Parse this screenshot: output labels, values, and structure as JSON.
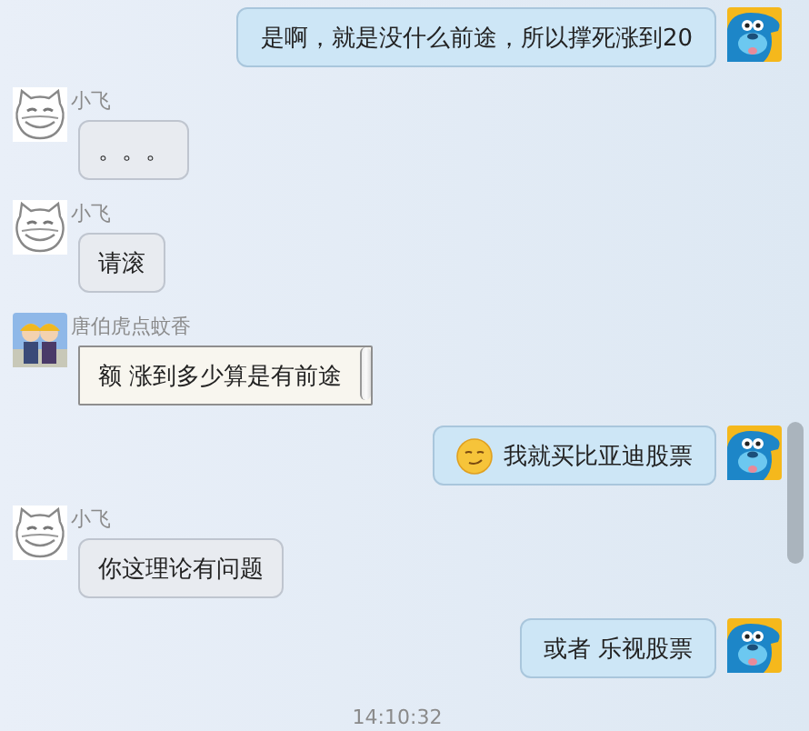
{
  "messages": [
    {
      "outgoing": true,
      "avatar": {
        "kind": "dog"
      },
      "bubble": {
        "kind": "plain"
      },
      "text": "是啊，就是没什么前途，所以撑死涨到20"
    },
    {
      "outgoing": false,
      "avatar": {
        "kind": "cat"
      },
      "sender": "小飞",
      "bubble": {
        "kind": "plain"
      },
      "text": "。。。"
    },
    {
      "outgoing": false,
      "avatar": {
        "kind": "cat"
      },
      "sender": "小飞",
      "bubble": {
        "kind": "plain"
      },
      "text": "请滚"
    },
    {
      "outgoing": false,
      "avatar": {
        "kind": "pair"
      },
      "sender": "唐伯虎点蚊香",
      "bubble": {
        "kind": "scroll"
      },
      "text": "额 涨到多少算是有前途"
    },
    {
      "outgoing": true,
      "avatar": {
        "kind": "dog"
      },
      "bubble": {
        "kind": "emoji"
      },
      "text": "我就买比亚迪股票"
    },
    {
      "outgoing": false,
      "avatar": {
        "kind": "cat"
      },
      "sender": "小飞",
      "bubble": {
        "kind": "plain"
      },
      "text": "你这理论有问题"
    },
    {
      "outgoing": true,
      "avatar": {
        "kind": "dog"
      },
      "bubble": {
        "kind": "plain"
      },
      "text": "或者 乐视股票"
    }
  ],
  "timestamp": "14:10:32"
}
